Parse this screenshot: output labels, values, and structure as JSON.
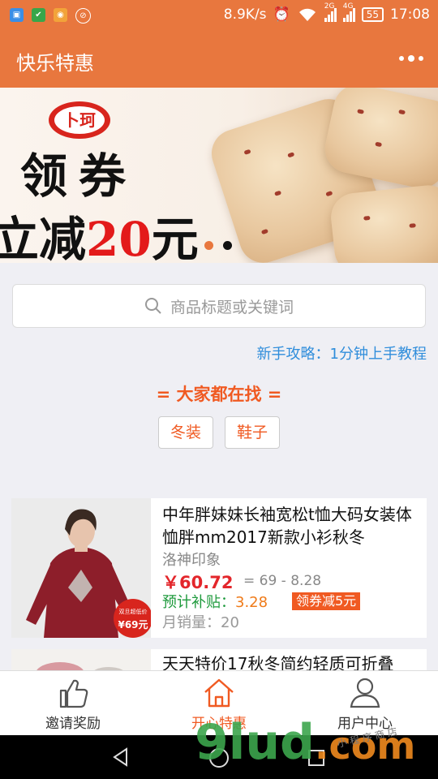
{
  "status_bar": {
    "speed": "8.9K/s",
    "net1": "2G",
    "net2": "4G",
    "battery": "55",
    "time": "17:08"
  },
  "header": {
    "title": "快乐特惠"
  },
  "banner": {
    "brand": "卜珂",
    "line1": "领券",
    "line2_prefix": "立减",
    "line2_number": "20",
    "line2_suffix": "元"
  },
  "search": {
    "placeholder": "商品标题或关键词"
  },
  "guide_link": "新手攻略：1分钟上手教程",
  "hot": {
    "title": "= 大家都在找 =",
    "tags": [
      "冬装",
      "鞋子"
    ]
  },
  "products": [
    {
      "title": "中年胖妹妹长袖宽松t恤大码女装体恤胖mm2017新款小衫秋冬",
      "shop": "洛神印象",
      "price": "￥60.72",
      "range": "= 69 - 8.28",
      "subsidy_label": "预计补贴：",
      "subsidy_value": "3.28",
      "coupon": "领券减5元",
      "sales": "月销量：20",
      "thumb_badge_top": "双旦超低价",
      "thumb_badge_price": "¥69元"
    },
    {
      "title": "天天特价17秋冬简约轻质可折叠"
    }
  ],
  "tabbar": {
    "invite": "邀请奖励",
    "home": "开心特惠",
    "user": "用户中心"
  },
  "watermark": {
    "main": "9lud",
    "suffix": ".com",
    "small": "小 程 序 商 店"
  },
  "colors": {
    "primary": "#e8773e",
    "accent": "#f05a22",
    "price": "#e3262b",
    "link": "#2f8ddb"
  }
}
